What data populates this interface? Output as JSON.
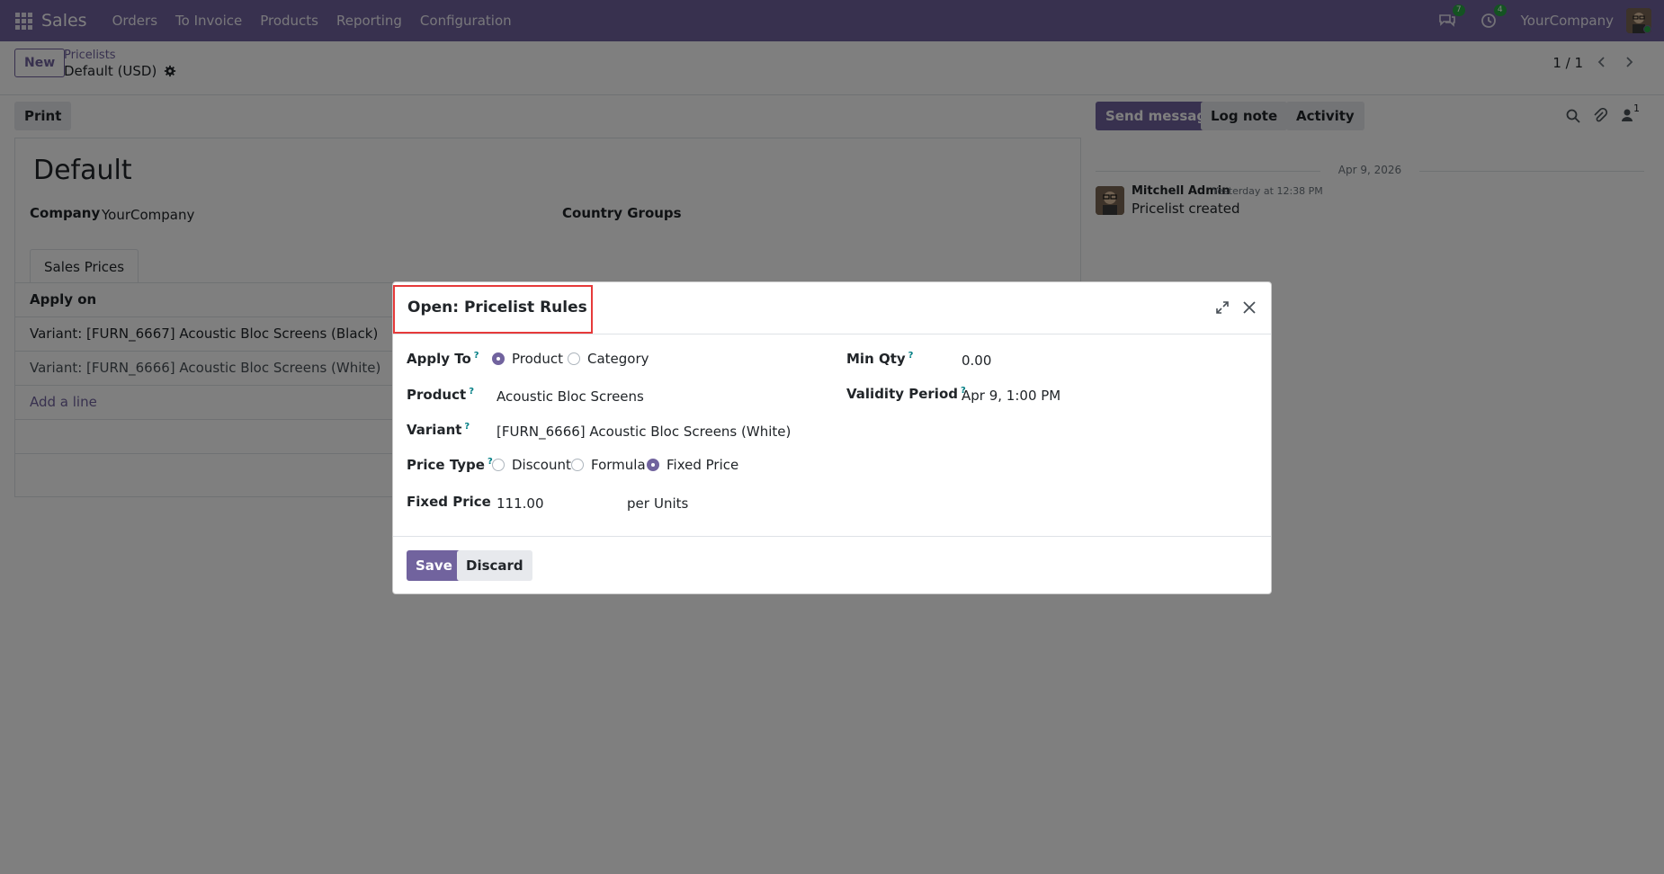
{
  "navbar": {
    "app_name": "Sales",
    "menu": [
      "Orders",
      "To Invoice",
      "Products",
      "Reporting",
      "Configuration"
    ],
    "messages_badge": "7",
    "activities_badge": "4",
    "company": "YourCompany",
    "bg_color": "#71639e"
  },
  "control": {
    "new_label": "New",
    "breadcrumb": "Pricelists",
    "record_name": "Default (USD)",
    "pager": "1 / 1"
  },
  "form": {
    "print_label": "Print",
    "title": "Default",
    "company_label": "Company",
    "company_value": "YourCompany",
    "country_groups_label": "Country Groups",
    "tab_label": "Sales Prices",
    "column_apply_on": "Apply on",
    "rows": [
      "Variant: [FURN_6667] Acoustic Bloc Screens (Black)",
      "Variant: [FURN_6666] Acoustic Bloc Screens (White)"
    ],
    "add_line": "Add a line"
  },
  "chatter": {
    "send_message": "Send message",
    "log_note": "Log note",
    "activity": "Activity",
    "followers_count": "1",
    "date": "Apr 9, 2026",
    "author": "Mitchell Admin",
    "time": "Yesterday at 12:38 PM",
    "message": "Pricelist created"
  },
  "dialog": {
    "title": "Open: Pricelist Rules",
    "apply_to_label": "Apply To",
    "apply_to_options": [
      "Product",
      "Category"
    ],
    "apply_to_selected": "Product",
    "product_label": "Product",
    "product_value": "Acoustic Bloc Screens",
    "variant_label": "Variant",
    "variant_value": "[FURN_6666] Acoustic Bloc Screens (White)",
    "price_type_label": "Price Type",
    "price_type_options": [
      "Discount",
      "Formula",
      "Fixed Price"
    ],
    "price_type_selected": "Fixed Price",
    "fixed_price_label": "Fixed Price",
    "fixed_price_value": "111.00",
    "per_label": "per",
    "uom_value": "Units",
    "min_qty_label": "Min Qty",
    "min_qty_value": "0.00",
    "validity_label": "Validity Period",
    "validity_value": "Apr 9, 1:00 PM",
    "help_mark": "?",
    "save_label": "Save",
    "discard_label": "Discard"
  }
}
